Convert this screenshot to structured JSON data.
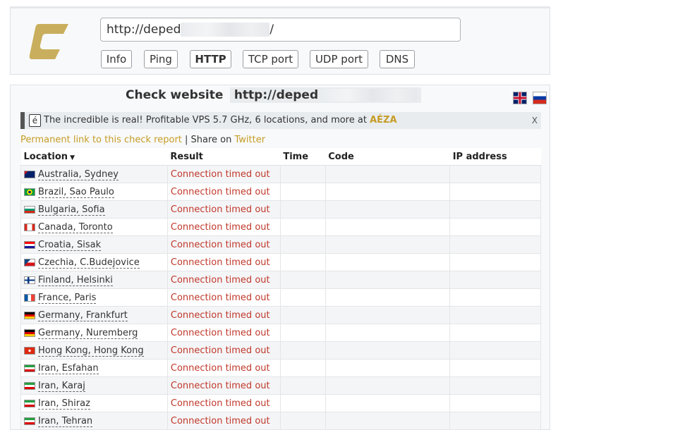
{
  "header": {
    "url_value": "http://deped",
    "url_suffix": "/",
    "tabs": [
      {
        "label": "Info",
        "active": false
      },
      {
        "label": "Ping",
        "active": false
      },
      {
        "label": "HTTP",
        "active": true
      },
      {
        "label": "TCP port",
        "active": false
      },
      {
        "label": "UDP port",
        "active": false
      },
      {
        "label": "DNS",
        "active": false
      }
    ]
  },
  "check": {
    "title_label": "Check website",
    "url": "http://deped",
    "lang_flags": [
      "uk-flag-icon",
      "russia-flag-icon"
    ]
  },
  "ad": {
    "icon_glyph": "é",
    "text": "The incredible is real! Profitable VPS 5.7 GHz, 6 locations, and more at",
    "brand": "AÉZA",
    "close": "X"
  },
  "links": {
    "permalink": "Permanent link to this check report",
    "separator": " | Share on ",
    "twitter": "Twitter"
  },
  "table": {
    "columns": [
      "Location",
      "Result",
      "Time",
      "Code",
      "IP address"
    ],
    "sort_indicator": "▼",
    "rows": [
      {
        "flag": "au",
        "location": "Australia, Sydney",
        "result": "Connection timed out"
      },
      {
        "flag": "br",
        "location": "Brazil, Sao Paulo",
        "result": "Connection timed out"
      },
      {
        "flag": "bg",
        "location": "Bulgaria, Sofia",
        "result": "Connection timed out"
      },
      {
        "flag": "ca",
        "location": "Canada, Toronto",
        "result": "Connection timed out"
      },
      {
        "flag": "hr",
        "location": "Croatia, Sisak",
        "result": "Connection timed out"
      },
      {
        "flag": "cz",
        "location": "Czechia, C.Budejovice",
        "result": "Connection timed out"
      },
      {
        "flag": "fi",
        "location": "Finland, Helsinki",
        "result": "Connection timed out"
      },
      {
        "flag": "fr",
        "location": "France, Paris",
        "result": "Connection timed out"
      },
      {
        "flag": "de",
        "location": "Germany, Frankfurt",
        "result": "Connection timed out"
      },
      {
        "flag": "de",
        "location": "Germany, Nuremberg",
        "result": "Connection timed out"
      },
      {
        "flag": "hk",
        "location": "Hong Kong, Hong Kong",
        "result": "Connection timed out"
      },
      {
        "flag": "ir",
        "location": "Iran, Esfahan",
        "result": "Connection timed out"
      },
      {
        "flag": "ir",
        "location": "Iran, Karaj",
        "result": "Connection timed out"
      },
      {
        "flag": "ir",
        "location": "Iran, Shiraz",
        "result": "Connection timed out"
      },
      {
        "flag": "ir",
        "location": "Iran, Tehran",
        "result": "Connection timed out"
      }
    ]
  },
  "colors": {
    "brand_gold": "#c69c26",
    "error_red": "#c0392b"
  }
}
